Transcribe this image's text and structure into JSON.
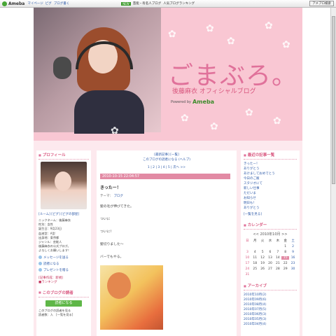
{
  "topbar": {
    "brand": "Ameba",
    "links": [
      "マイページ",
      "ピグ",
      "ブログ書く"
    ],
    "news_badge": "NEW",
    "news_text": "芸能・有名人ブログ",
    "promo_text": "人気ブログランキング",
    "search_button": "アメブロ検索"
  },
  "header": {
    "title": "ごまぶろ。",
    "subtitle": "後藤麻衣 オフィシャルブログ",
    "powered_by": "Powered by",
    "powered_brand": "Ameba"
  },
  "left": {
    "profile_heading": "プロフィール",
    "profile_links": "[ルーム] [ピグ] [ピグの部屋]",
    "profile_lines": [
      "ニックネーム：後藤麻衣",
      "性別：女性",
      "誕生日：9月23日",
      "血液型：A型",
      "出身地：東京都",
      "ジャンル：芸能人",
      "後藤麻衣の公式ブログ。",
      "よろしくお願いします！"
    ],
    "message_link": "メッセージを送る",
    "reader_link": "読者になる",
    "present_link": "プレゼントを贈る",
    "counter_label": "[記事作成：新規]",
    "counter_text": "■ランキング",
    "reader_heading": "このブログの読者",
    "reader_button": "読者になる",
    "reader_desc_1": "このブログの読者を見る",
    "reader_desc_2": "読者数：人　[一覧を見る]"
  },
  "center": {
    "theme_link": "[最新記事] [一覧]",
    "reader_line": "このブログの読者になる (ヘルプ)",
    "pager": "1 | 2 | 3 | 4 | 5 | 次へ >>",
    "date": "2010-10-15 22:04:57",
    "entry_title": "きったー！",
    "theme_label": "テーマ：",
    "theme_value": "ブログ",
    "lines": [
      "髪の毛が伸びてきた。",
      "ついに",
      "ついに！",
      "髪切りました〜",
      "バーでもやる。"
    ]
  },
  "right": {
    "recent_heading": "最近の記事一覧",
    "recent": [
      "きったー！",
      "ありがとう",
      "あけましておめでとう",
      "今日のご飯",
      "スタジオにて",
      "新しい仕事",
      "ただいま",
      "お知らせ",
      "明日も！",
      "ありがとう"
    ],
    "all_link": "[一覧を見る]",
    "calendar_heading": "カレンダー",
    "calendar_month": "<<   2010年10月   >>",
    "weekdays": [
      "日",
      "月",
      "火",
      "水",
      "木",
      "金",
      "土"
    ],
    "days": [
      "",
      "",
      "",
      "",
      "",
      "1",
      "2",
      "3",
      "4",
      "5",
      "6",
      "7",
      "8",
      "9",
      "10",
      "11",
      "12",
      "13",
      "14",
      "15",
      "16",
      "17",
      "18",
      "19",
      "20",
      "21",
      "22",
      "23",
      "24",
      "25",
      "26",
      "27",
      "28",
      "29",
      "30",
      "31"
    ],
    "highlight_day": "15",
    "archive_heading": "アーカイブ",
    "archive": [
      "2010年10月(2)",
      "2010年09月(6)",
      "2010年08月(4)",
      "2010年07月(5)",
      "2010年06月(3)",
      "2010年05月(3)",
      "2010年04月(4)"
    ]
  }
}
